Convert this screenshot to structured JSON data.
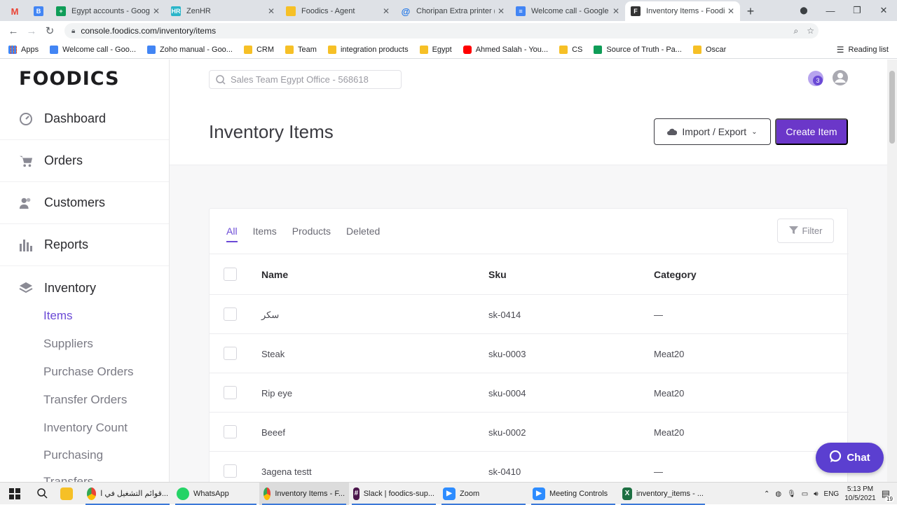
{
  "browser": {
    "tabs": [
      {
        "title": "",
        "favicon": "gmail-icon",
        "color": "#ea4335"
      },
      {
        "title": "",
        "favicon": "blogger-icon",
        "color": "#4285f4"
      },
      {
        "title": "Egypt accounts - Google",
        "favicon": "sheets-icon",
        "color": "#0f9d58"
      },
      {
        "title": "ZenHR",
        "favicon": "zenhr-icon",
        "color": "#2bb5c9"
      },
      {
        "title": "Foodics - Agent",
        "favicon": "folder-icon",
        "color": "#f6c026"
      },
      {
        "title": "Choripan Extra printer (C",
        "favicon": "at-icon",
        "color": "#1a73e8"
      },
      {
        "title": "Welcome call - Google D",
        "favicon": "docs-icon",
        "color": "#4285f4"
      },
      {
        "title": "Inventory Items - Foodics",
        "favicon": "foodics-icon",
        "color": "#333333"
      }
    ],
    "url": "console.foodics.com/inventory/items",
    "profile_initial": "A",
    "bookmarks": [
      {
        "label": "Apps",
        "type": "apps"
      },
      {
        "label": "Welcome call - Goo...",
        "type": "docs"
      },
      {
        "label": "Zoho manual - Goo...",
        "type": "docs"
      },
      {
        "label": "CRM",
        "type": "folder"
      },
      {
        "label": "Team",
        "type": "folder"
      },
      {
        "label": "integration products",
        "type": "folder"
      },
      {
        "label": "Egypt",
        "type": "folder"
      },
      {
        "label": "Ahmed Salah - You...",
        "type": "youtube"
      },
      {
        "label": "CS",
        "type": "folder"
      },
      {
        "label": "Source of Truth - Pa...",
        "type": "sheets"
      },
      {
        "label": "Oscar",
        "type": "folder"
      }
    ],
    "reading_list": "Reading list"
  },
  "app": {
    "logo": "FOODICS",
    "search_placeholder": "Sales Team Egypt Office - 568618",
    "notification_count": "3",
    "nav": [
      {
        "label": "Dashboard",
        "icon": "dashboard-icon"
      },
      {
        "label": "Orders",
        "icon": "cart-icon"
      },
      {
        "label": "Customers",
        "icon": "customers-icon"
      },
      {
        "label": "Reports",
        "icon": "reports-icon"
      },
      {
        "label": "Inventory",
        "icon": "layers-icon"
      }
    ],
    "inventory_sub": [
      "Items",
      "Suppliers",
      "Purchase Orders",
      "Transfer Orders",
      "Inventory Count",
      "Purchasing",
      "Transfers"
    ],
    "page_title": "Inventory Items",
    "import_export_label": "Import / Export",
    "create_label": "Create Item",
    "filter_tabs": [
      "All",
      "Items",
      "Products",
      "Deleted"
    ],
    "filter_label": "Filter",
    "columns": [
      "Name",
      "Sku",
      "Category"
    ],
    "rows": [
      {
        "name": "سكر",
        "sku": "sk-0414",
        "category": "—"
      },
      {
        "name": "Steak",
        "sku": "sku-0003",
        "category": "Meat20"
      },
      {
        "name": "Rip eye",
        "sku": "sku-0004",
        "category": "Meat20"
      },
      {
        "name": "Beeef",
        "sku": "sku-0002",
        "category": "Meat20"
      },
      {
        "name": "3agena testt",
        "sku": "sk-0410",
        "category": "—"
      }
    ],
    "chat_label": "Chat",
    "accent": "#6b37c9"
  },
  "taskbar": {
    "apps": [
      {
        "label": "قوائم التشغيل في ا...",
        "icon": "chrome-icon"
      },
      {
        "label": "WhatsApp",
        "icon": "whatsapp-icon"
      },
      {
        "label": "Inventory Items - F...",
        "icon": "chrome-icon"
      },
      {
        "label": "Slack | foodics-sup...",
        "icon": "slack-icon"
      },
      {
        "label": "Zoom",
        "icon": "zoom-icon"
      },
      {
        "label": "Meeting Controls",
        "icon": "zoom-icon"
      },
      {
        "label": "inventory_items - ...",
        "icon": "excel-icon"
      }
    ],
    "language": "ENG",
    "time": "5:13 PM",
    "date": "10/5/2021",
    "notification_count": "19"
  }
}
